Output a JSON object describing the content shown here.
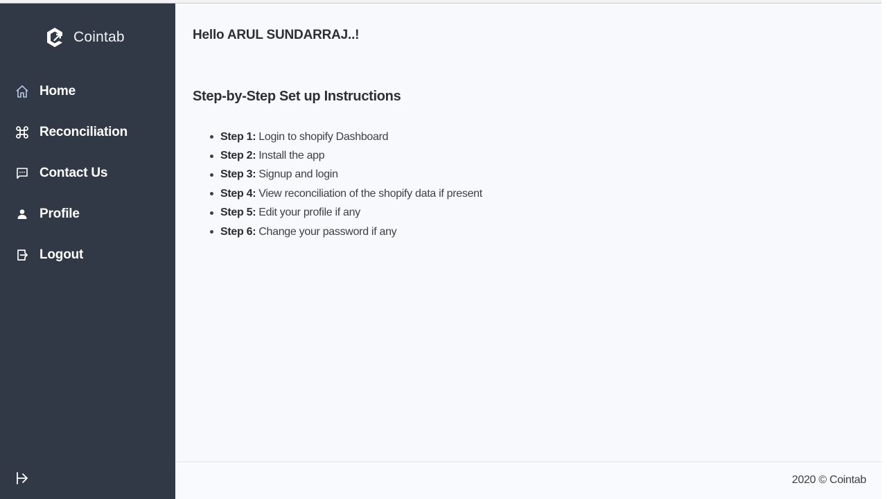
{
  "app": {
    "brand_name": "Cointab",
    "brand_icon": "cointab-logo-icon"
  },
  "sidebar": {
    "items": [
      {
        "label": "Home",
        "icon": "home-icon"
      },
      {
        "label": "Reconciliation",
        "icon": "command-icon"
      },
      {
        "label": "Contact Us",
        "icon": "message-square-icon"
      },
      {
        "label": "Profile",
        "icon": "user-icon"
      },
      {
        "label": "Logout",
        "icon": "logout-icon"
      }
    ],
    "collapse_icon": "arrow-right-from-line-icon"
  },
  "main": {
    "greeting": "Hello ARUL SUNDARRAJ..!",
    "section_title": "Step-by-Step Set up Instructions",
    "steps": [
      {
        "key": "Step 1:",
        "text": "Login to shopify Dashboard"
      },
      {
        "key": "Step 2:",
        "text": "Install the app"
      },
      {
        "key": "Step 3:",
        "text": "Signup and login"
      },
      {
        "key": "Step 4:",
        "text": "View reconciliation of the shopify data if present"
      },
      {
        "key": "Step 5:",
        "text": "Edit your profile if any"
      },
      {
        "key": "Step 6:",
        "text": "Change your password if any"
      }
    ]
  },
  "footer": {
    "text": "2020 © Cointab"
  },
  "colors": {
    "sidebar_bg": "#313846",
    "main_bg": "#f8f9fd",
    "text_dark": "#2c2f33"
  }
}
